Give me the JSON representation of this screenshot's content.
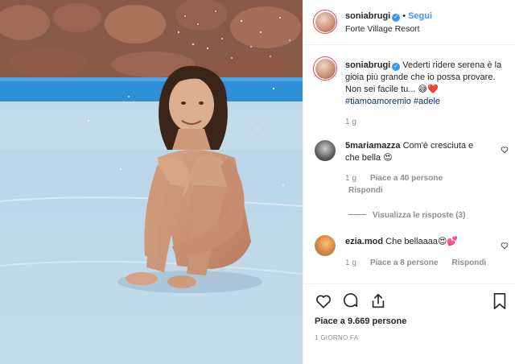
{
  "post": {
    "username": "soniabrugi",
    "follow_label": "Segui",
    "location": "Forte Village Resort",
    "caption_text": "Vederti ridere serena è la gioia più grande che io possa provare. Non sei facile tu... 😅❤️",
    "caption_line1": "Vederti ridere serena è la",
    "caption_line2": "gioia più grande che io possa provare.",
    "caption_line3": "Non sei facile tu...",
    "caption_emoji": "😅❤️",
    "hashtag1": "#tiamoamoremio",
    "hashtag2": "#adele",
    "caption_age": "1 g"
  },
  "comments": [
    {
      "username": "5mariamazza",
      "text_line1": "Com'è cresciuta e",
      "text_line2": "che bella 😍",
      "age": "1 g",
      "likes": "Piace a 40 persone",
      "reply": "Rispondi",
      "view_replies": "Visualizza le risposte (3)"
    },
    {
      "username": "ezia.mod",
      "text": "Che bellaaaa😍💕",
      "age": "1 g",
      "likes": "Piace a 8 persone",
      "reply": "Rispondi"
    }
  ],
  "footer": {
    "likes": "Piace a 9.669 persone",
    "time": "1 GIORNO FA"
  },
  "icons": [
    "heart-icon",
    "comment-icon",
    "share-icon",
    "bookmark-icon",
    "verified-icon"
  ],
  "colors": {
    "accent": "#3897f0",
    "link": "#00376b",
    "heart_red": "#ed4956"
  }
}
